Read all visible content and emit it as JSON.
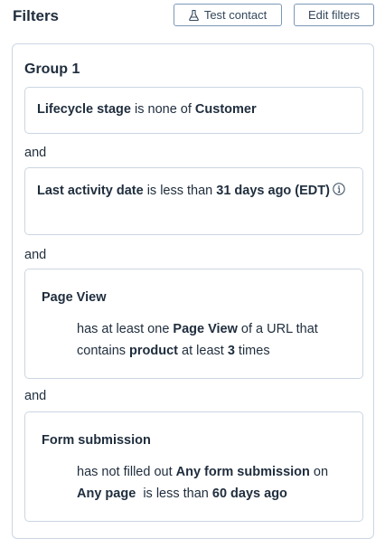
{
  "header": {
    "title": "Filters",
    "test_contact_label": "Test contact",
    "edit_filters_label": "Edit filters"
  },
  "group": {
    "title": "Group 1",
    "connector": "and",
    "filters": [
      {
        "property": "Lifecycle stage",
        "operator": " is none of ",
        "value": "Customer"
      },
      {
        "property": "Last activity date",
        "operator": " is less than ",
        "value": "31 days ago (EDT)",
        "info_icon": "info-icon"
      },
      {
        "event": "Page View",
        "desc_pre": "has at least one ",
        "desc_event": "Page View",
        "desc_mid": " of a URL that contains ",
        "desc_value": "product",
        "desc_mid2": " at least ",
        "desc_count": "3",
        "desc_post": " times"
      },
      {
        "event": "Form submission",
        "desc_pre": "has not filled out ",
        "desc_form": "Any form submission",
        "desc_mid": " on ",
        "desc_page": "Any page",
        "desc_mid2": "  is less than ",
        "desc_value": "60 days ago"
      }
    ]
  },
  "colors": {
    "text": "#1f2d3d",
    "border": "#cbd6e2",
    "button_border": "#7c98b6"
  }
}
